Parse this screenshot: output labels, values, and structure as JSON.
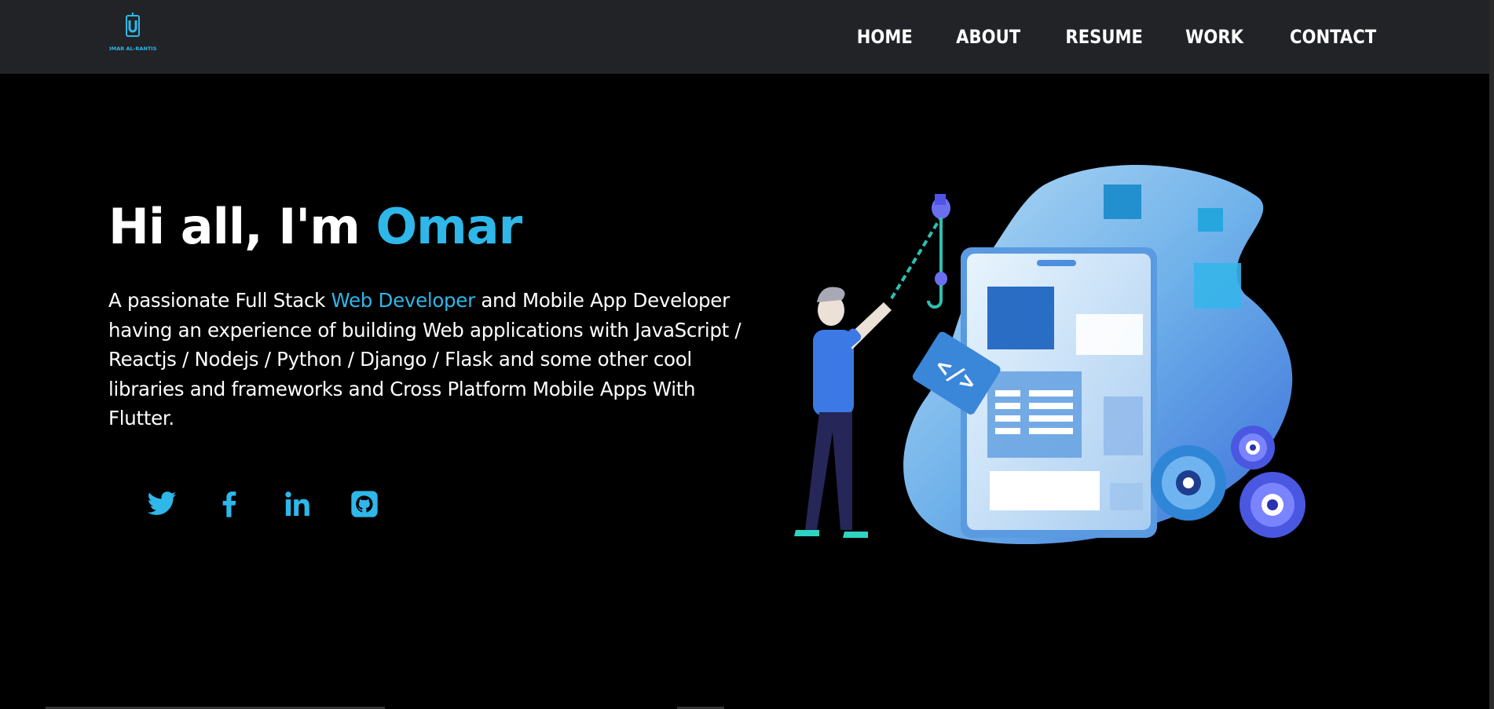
{
  "logo": {
    "text": "OMAR AL-RANTISI",
    "icon": "logo-mark"
  },
  "nav": {
    "items": [
      {
        "label": "HOME"
      },
      {
        "label": "ABOUT"
      },
      {
        "label": "RESUME"
      },
      {
        "label": "WORK"
      },
      {
        "label": "CONTACT"
      }
    ]
  },
  "hero": {
    "greeting": "Hi all, I'm ",
    "name": "Omar",
    "desc_part1": "A passionate Full Stack ",
    "desc_highlight": "Web Developer",
    "desc_part2": " and Mobile App Developer having an experience of building Web applications with JavaScript / Reactjs / Nodejs / Python / Django / Flask and some other cool libraries and frameworks and Cross Platform Mobile Apps With Flutter."
  },
  "social": [
    {
      "icon": "twitter-icon"
    },
    {
      "icon": "facebook-icon"
    },
    {
      "icon": "linkedin-icon"
    },
    {
      "icon": "github-icon"
    }
  ],
  "colors": {
    "accent": "#2fb7e9",
    "navbar_bg": "#212327",
    "page_bg": "#000000"
  }
}
